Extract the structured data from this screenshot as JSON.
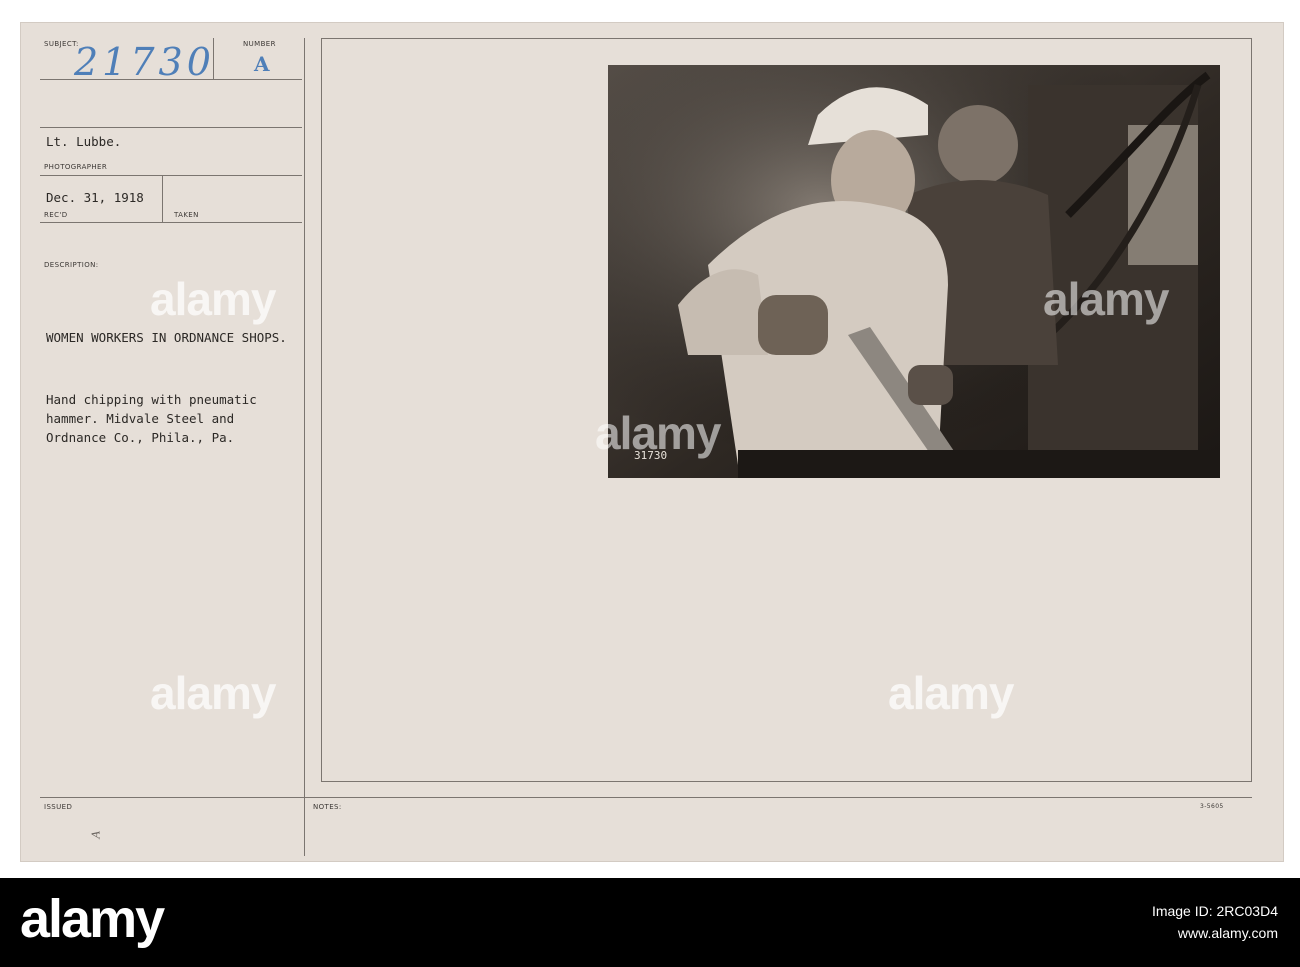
{
  "card": {
    "subject_label": "SUBJECT:",
    "subject_number": "21730",
    "number_label": "NUMBER",
    "number_value": "A",
    "photographer_name": "Lt. Lubbe.",
    "photographer_label": "PHOTOGRAPHER",
    "received_date": "Dec. 31, 1918",
    "recd_label": "REC'D",
    "taken_label": "TAKEN",
    "description_label": "DESCRIPTION:",
    "title": "WOMEN WORKERS IN ORDNANCE SHOPS.",
    "description_lines": [
      "Hand chipping with pneumatic",
      "hammer. Midvale Steel and",
      "Ordnance Co., Phila., Pa."
    ],
    "issued_label": "ISSUED",
    "issued_mark": "A",
    "notes_label": "NOTES:",
    "form_code": "3-5605",
    "photo_caption_number": "31730"
  },
  "watermark_text": "alamy",
  "footer": {
    "logo": "alamy",
    "image_id_line": "Image ID: 2RC03D4",
    "site_line": "www.alamy.com"
  },
  "colors": {
    "card": "#e6dfd8",
    "ink_blue": "#4f7fb8",
    "photo_dark": "#2a2420"
  }
}
